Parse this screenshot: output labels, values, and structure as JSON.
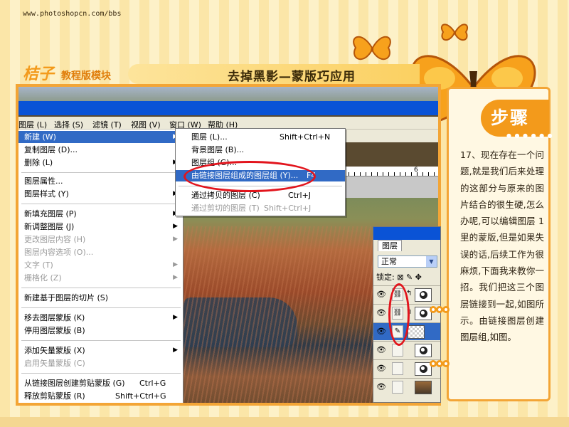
{
  "site_url": "www.photoshopcn.com/bbs",
  "logo": {
    "brand": "桔子",
    "section": "教程版模块"
  },
  "title": "去掉黑影—蒙版巧应用",
  "menubar": {
    "items": [
      "图层 (L)",
      "选择 (S)",
      "滤镜 (T)",
      "视图 (V)",
      "窗口 (W)",
      "帮助 (H)"
    ]
  },
  "layer_menu": {
    "items": [
      {
        "label": "新建 (W)",
        "shortcut": "",
        "submenu": true,
        "state": "highlighted"
      },
      {
        "label": "复制图层 (D)...",
        "shortcut": "",
        "submenu": false,
        "state": "normal"
      },
      {
        "label": "删除 (L)",
        "shortcut": "",
        "submenu": true,
        "state": "normal"
      },
      {
        "label": "图层属性...",
        "shortcut": "",
        "submenu": false,
        "state": "normal"
      },
      {
        "label": "图层样式 (Y)",
        "shortcut": "",
        "submenu": true,
        "state": "normal"
      },
      {
        "label": "新填充图层 (P)",
        "shortcut": "",
        "submenu": true,
        "state": "normal"
      },
      {
        "label": "新调整图层 (J)",
        "shortcut": "",
        "submenu": true,
        "state": "normal"
      },
      {
        "label": "更改图层内容 (H)",
        "shortcut": "",
        "submenu": true,
        "state": "disabled"
      },
      {
        "label": "图层内容选项 (O)...",
        "shortcut": "",
        "submenu": false,
        "state": "disabled"
      },
      {
        "label": "文字 (T)",
        "shortcut": "",
        "submenu": true,
        "state": "disabled"
      },
      {
        "label": "栅格化 (Z)",
        "shortcut": "",
        "submenu": true,
        "state": "disabled"
      },
      {
        "label": "新建基于图层的切片 (S)",
        "shortcut": "",
        "submenu": false,
        "state": "normal"
      },
      {
        "label": "移去图层蒙版 (K)",
        "shortcut": "",
        "submenu": true,
        "state": "normal"
      },
      {
        "label": "停用图层蒙版 (B)",
        "shortcut": "",
        "submenu": false,
        "state": "normal"
      },
      {
        "label": "添加矢量蒙版 (X)",
        "shortcut": "",
        "submenu": true,
        "state": "normal"
      },
      {
        "label": "启用矢量蒙版 (C)",
        "shortcut": "",
        "submenu": false,
        "state": "disabled"
      },
      {
        "label": "从链接图层创建剪贴蒙版 (G)",
        "shortcut": "Ctrl+G",
        "submenu": false,
        "state": "normal"
      },
      {
        "label": "释放剪贴蒙版 (R)",
        "shortcut": "Shift+Ctrl+G",
        "submenu": false,
        "state": "normal"
      }
    ]
  },
  "new_submenu": {
    "items": [
      {
        "label": "图层 (L)...",
        "shortcut": "Shift+Ctrl+N",
        "state": "normal"
      },
      {
        "label": "背景图层 (B)...",
        "shortcut": "",
        "state": "normal"
      },
      {
        "label": "图层组 (G)...",
        "shortcut": "",
        "state": "normal"
      },
      {
        "label": "由链接图层组成的图层组 (Y)...",
        "shortcut": "F4",
        "state": "highlighted"
      },
      {
        "label": "通过拷贝的图层 (C)",
        "shortcut": "Ctrl+J",
        "state": "normal"
      },
      {
        "label": "通过剪切的图层 (T)",
        "shortcut": "Shift+Ctrl+J",
        "state": "disabled"
      }
    ]
  },
  "ruler_label": "6",
  "layers_panel": {
    "tab": "图层",
    "blend_mode": "正常",
    "lock_label": "锁定:"
  },
  "step": {
    "badge": "步骤",
    "description": "17、现在存在一个问题,就是我们后来处理的这部分与原来的图片结合的很生硬,怎么办呢,可以编辑图层 1 里的蒙版,但是如果失误的话,后续工作为很麻烦,下面我来教你一招。我们把这三个图层链接到一起,如图所示。由链接图层创建图层组,如图。"
  },
  "colors": {
    "accent": "#f39a1b",
    "menu_highlight": "#316ac5",
    "annotation_red": "#e2141c",
    "title_blue": "#0a53d6"
  }
}
